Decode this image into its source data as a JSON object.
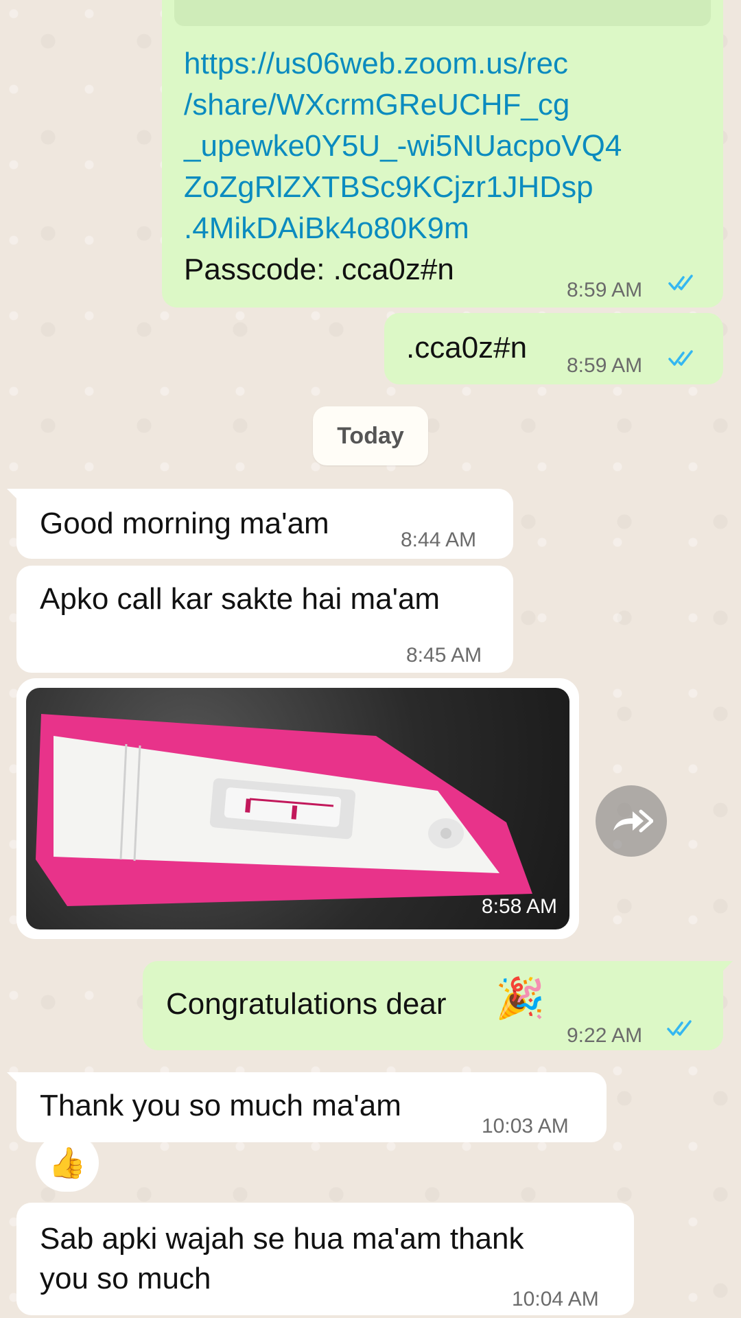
{
  "messages": [
    {
      "link_lines": [
        "https://us06web.zoom.us/rec",
        "/share/WXcrmGReUCHF_cg",
        "_upewke0Y5U_-wi5NUacpoVQ4",
        "ZoZgRlZXTBSc9KCjzr1JHDsp",
        ".4MikDAiBk4o80K9m"
      ],
      "passcode_line": "Passcode: .cca0z#n",
      "time": "8:59 AM"
    },
    {
      "text": ".cca0z#n",
      "time": "8:59 AM"
    },
    {
      "text": "Good morning ma'am",
      "time": "8:44 AM"
    },
    {
      "text": "Apko call kar sakte hai ma'am",
      "time": "8:45 AM"
    },
    {
      "image_time": "8:58 AM"
    },
    {
      "text": "Congratulations dear",
      "emoji": "🎉",
      "time": "9:22 AM"
    },
    {
      "text": "Thank you so much ma'am",
      "time": "10:03 AM",
      "reaction": "👍"
    },
    {
      "lines": [
        "Sab apki wajah se hua ma'am thank",
        "you so much"
      ],
      "time": "10:04 AM"
    }
  ],
  "date_divider": "Today",
  "colors": {
    "outgoing_bubble": "#dcf8c6",
    "incoming_bubble": "#ffffff",
    "link": "#0b8bbf",
    "read_ticks": "#34b7f1",
    "wallpaper": "#efe7de",
    "test_pink": "#e8338a"
  },
  "icons": [
    "double-check-icon",
    "forward-icon",
    "party-popper-emoji",
    "thumbs-up-emoji"
  ]
}
